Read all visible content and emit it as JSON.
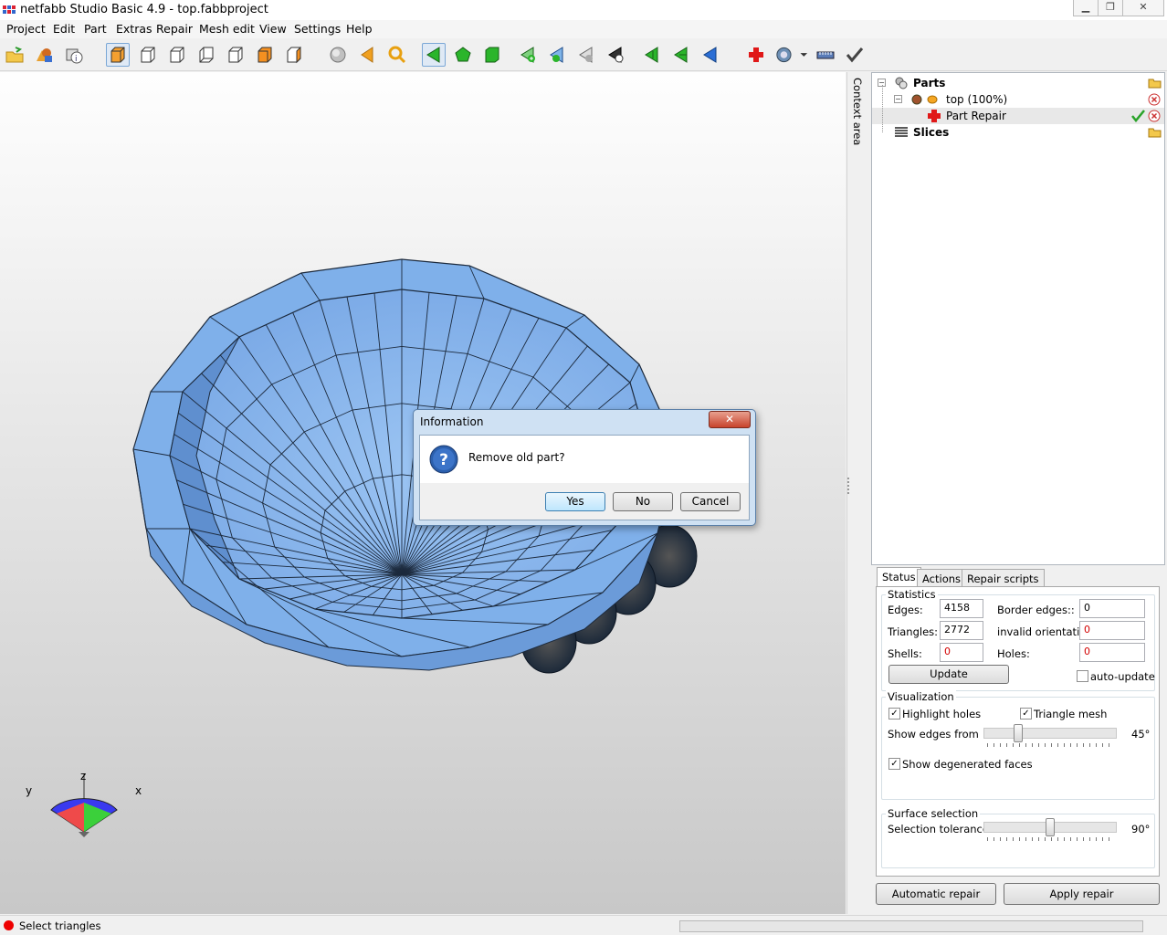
{
  "window": {
    "title": "netfabb Studio Basic 4.9 - top.fabbproject",
    "minimize": "▁",
    "restore": "❐",
    "close": "✕"
  },
  "menu": [
    "Project",
    "Edit",
    "Part",
    "Extras",
    "Repair",
    "Mesh edit",
    "View",
    "Settings",
    "Help"
  ],
  "viewport": {
    "axis_x": "x",
    "axis_y": "y",
    "axis_z": "z"
  },
  "context_area_label": "Context area",
  "tree": {
    "parts_label": "Parts",
    "part_label": "top (100%)",
    "repair_label": "Part Repair",
    "slices_label": "Slices"
  },
  "tabs": {
    "status": "Status",
    "actions": "Actions",
    "repair_scripts": "Repair scripts"
  },
  "statistics": {
    "title": "Statistics",
    "edges_label": "Edges:",
    "edges_value": "4158",
    "border_edges_label": "Border edges::",
    "border_edges_value": "0",
    "triangles_label": "Triangles:",
    "triangles_value": "2772",
    "invalid_orientation_label": "invalid orientation:",
    "invalid_orientation_value": "0",
    "shells_label": "Shells:",
    "shells_value": "0",
    "holes_label": "Holes:",
    "holes_value": "0",
    "update_label": "Update",
    "auto_update_label": "auto-update",
    "auto_update_checked": false
  },
  "visualization": {
    "title": "Visualization",
    "highlight_holes_label": "Highlight holes",
    "highlight_holes_checked": true,
    "triangle_mesh_label": "Triangle mesh",
    "triangle_mesh_checked": true,
    "show_edges_label": "Show edges from",
    "show_edges_value": "45°",
    "show_edges_level": 0.25,
    "degenerated_label": "Show degenerated faces",
    "degenerated_checked": true
  },
  "surface_selection": {
    "title": "Surface selection",
    "tolerance_label": "Selection tolerance:",
    "tolerance_value": "90°",
    "tolerance_level": 0.5
  },
  "buttons": {
    "automatic_repair": "Automatic repair",
    "apply_repair": "Apply repair"
  },
  "status_bar": {
    "text": "Select triangles"
  },
  "dialog": {
    "title": "Information",
    "message": "Remove old part?",
    "close": "✕",
    "yes": "Yes",
    "no": "No",
    "cancel": "Cancel"
  },
  "colors": {
    "mesh": "#87b6ee",
    "mesh_dark": "#5f8fcf",
    "accent": "#3c7fb1",
    "error": "#d20000"
  }
}
